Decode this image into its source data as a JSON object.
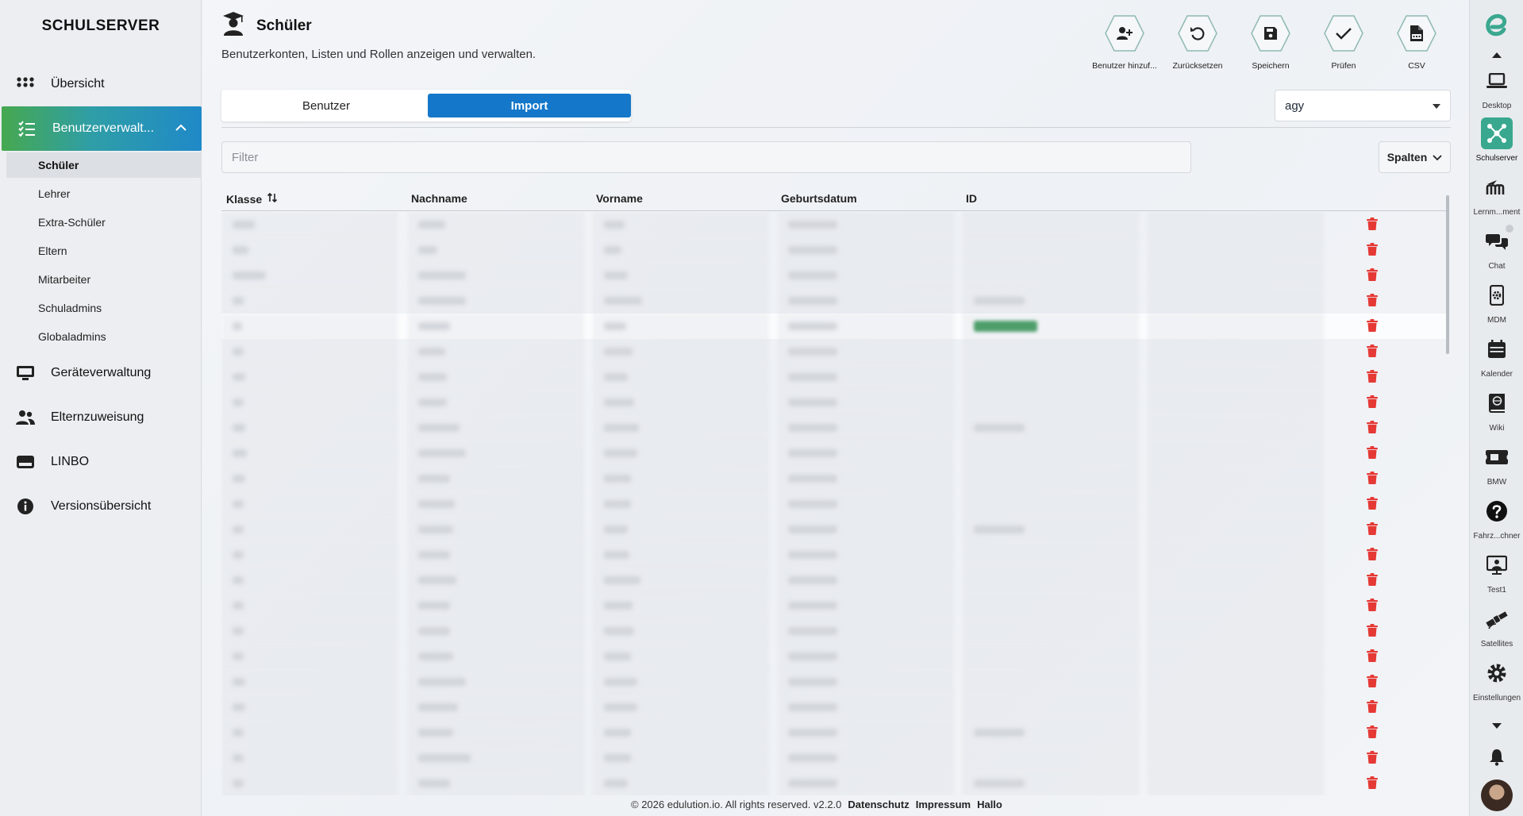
{
  "sidebar": {
    "brand": "SCHULSERVER",
    "items": [
      {
        "label": "Übersicht"
      },
      {
        "label": "Benutzerverwalt..."
      },
      {
        "label": "Geräteverwaltung"
      },
      {
        "label": "Elternzuweisung"
      },
      {
        "label": "LINBO"
      },
      {
        "label": "Versionsübersicht"
      }
    ],
    "subitems": [
      {
        "label": "Schüler"
      },
      {
        "label": "Lehrer"
      },
      {
        "label": "Extra-Schüler"
      },
      {
        "label": "Eltern"
      },
      {
        "label": "Mitarbeiter"
      },
      {
        "label": "Schuladmins"
      },
      {
        "label": "Globaladmins"
      }
    ]
  },
  "header": {
    "title": "Schüler",
    "subtitle": "Benutzerkonten, Listen und Rollen anzeigen und verwalten."
  },
  "toolbar": {
    "add_user": "Benutzer hinzuf...",
    "reset": "Zurücksetzen",
    "save": "Speichern",
    "check": "Prüfen",
    "csv": "CSV"
  },
  "tabs": {
    "users": "Benutzer",
    "import": "Import"
  },
  "school_select": {
    "value": "agy"
  },
  "filter": {
    "placeholder": "Filter"
  },
  "columns_button": "Spalten",
  "table": {
    "headers": {
      "class": "Klasse",
      "lastname": "Nachname",
      "firstname": "Vorname",
      "birthdate": "Geburtsdatum",
      "id": "ID"
    },
    "row_count": 23
  },
  "footer": {
    "copyright": "© 2026 edulution.io. All rights reserved. v2.2.0",
    "privacy": "Datenschutz",
    "imprint": "Impressum",
    "hello": "Hallo"
  },
  "dock": {
    "items": [
      {
        "label": "Desktop"
      },
      {
        "label": "Schulserver"
      },
      {
        "label": "Lernm...ment"
      },
      {
        "label": "Chat"
      },
      {
        "label": "MDM"
      },
      {
        "label": "Kalender"
      },
      {
        "label": "Wiki"
      },
      {
        "label": "BMW"
      },
      {
        "label": "Fahrz...chner"
      },
      {
        "label": "Test1"
      },
      {
        "label": "Satellites"
      },
      {
        "label": "Einstellungen"
      }
    ]
  },
  "colors": {
    "accent_blue": "#1477c9",
    "accent_green": "#46a84f",
    "danger": "#e53935"
  }
}
